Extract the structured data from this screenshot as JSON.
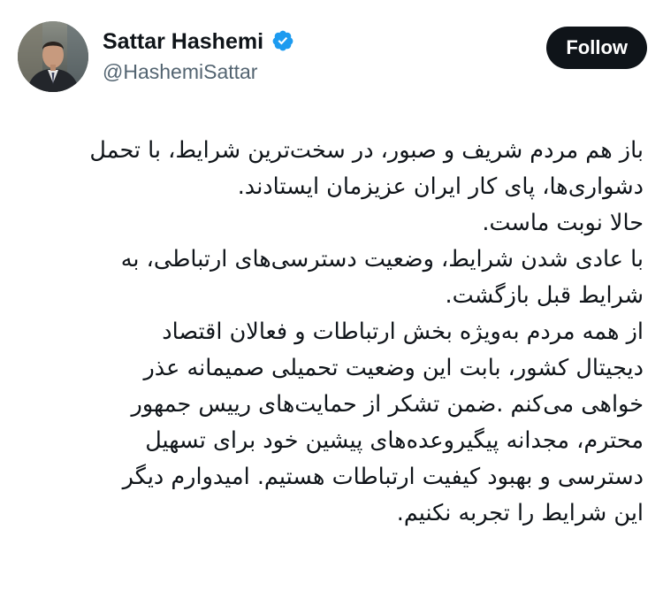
{
  "author": {
    "display_name": "Sattar Hashemi",
    "handle": "@HashemiSattar",
    "verified_icon": "verified-badge-icon",
    "accent_color": "#1d9bf0"
  },
  "follow_button": {
    "label": "Follow"
  },
  "tweet": {
    "lines": [
      "باز هم مردم شریف و صبور، در سخت‌ترین شرایط، با تحمل",
      "دشواری‌ها، پای کار ایران عزیزمان ایستادند.",
      "حالا نوبت ماست.",
      "با عادی شدن شرایط، وضعیت دسترسی‌های ارتباطی، به",
      "شرایط قبل بازگشت.",
      "از همه مردم به‌ویژه بخش ارتباطات و فعالان اقتصاد",
      "دیجیتال کشور، بابت این وضعیت تحمیلی صمیمانه عذر",
      "خواهی می‌کنم .ضمن تشکر از حمایت‌های رییس جمهور",
      "محترم، مجدانه پیگیروعده‌های پیشین خود برای تسهیل",
      "دسترسی و بهبود کیفیت ارتباطات هستیم. امیدوارم دیگر",
      "این شرایط را تجربه نکنیم."
    ]
  }
}
